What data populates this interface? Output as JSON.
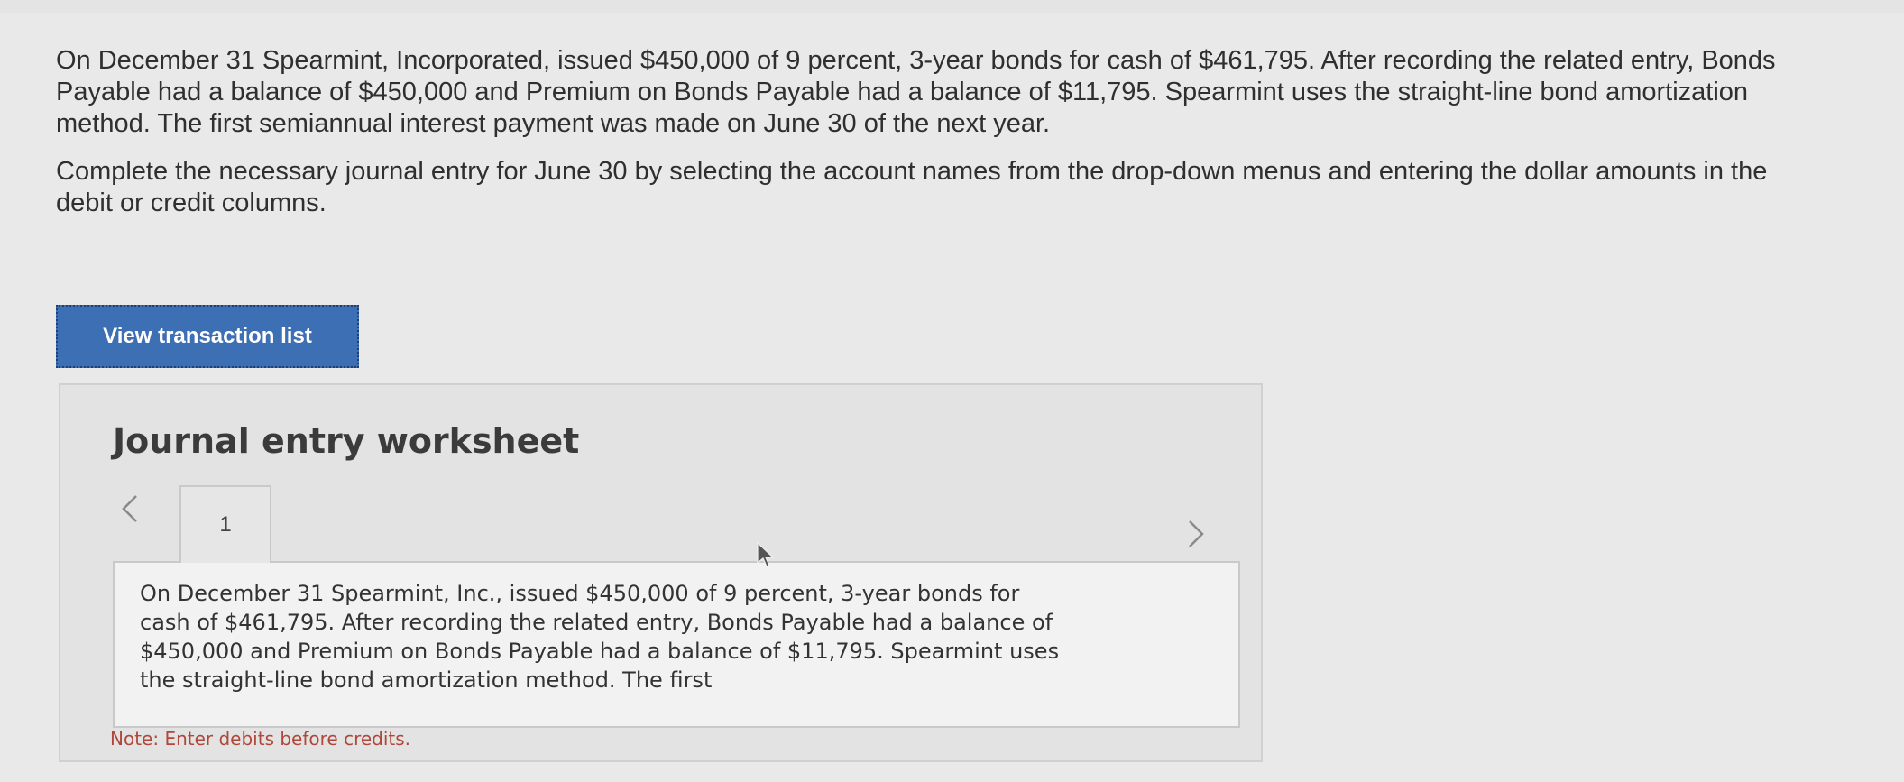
{
  "prompt": {
    "paragraph1": "On December 31 Spearmint, Incorporated, issued $450,000 of 9 percent, 3-year bonds for cash of $461,795. After recording the related entry, Bonds Payable had a balance of $450,000 and Premium on Bonds Payable had a balance of $11,795. Spearmint uses the straight-line bond amortization method. The first semiannual interest payment was made on June 30 of the next year.",
    "paragraph2": "Complete the necessary journal entry for June 30 by selecting the account names from the drop-down menus and entering the dollar amounts in the debit or credit columns."
  },
  "buttons": {
    "view_transaction_list": "View transaction list"
  },
  "worksheet": {
    "title": "Journal entry worksheet",
    "tabs": [
      {
        "label": "1"
      }
    ],
    "description": "On December 31 Spearmint, Inc., issued $450,000 of 9 percent, 3-year bonds for cash of $461,795. After recording the related entry, Bonds Payable had a balance of $450,000 and Premium on Bonds Payable had a balance of $11,795. Spearmint uses the straight-line bond amortization method. The first",
    "note": "Note: Enter debits before credits."
  },
  "icons": {
    "prev": "chevron-left-icon",
    "next": "chevron-right-icon",
    "cursor": "mouse-pointer-icon"
  },
  "colors": {
    "button_bg": "#3d6fb4",
    "note_text": "#b0473a",
    "page_bg": "#e9e9e9"
  }
}
